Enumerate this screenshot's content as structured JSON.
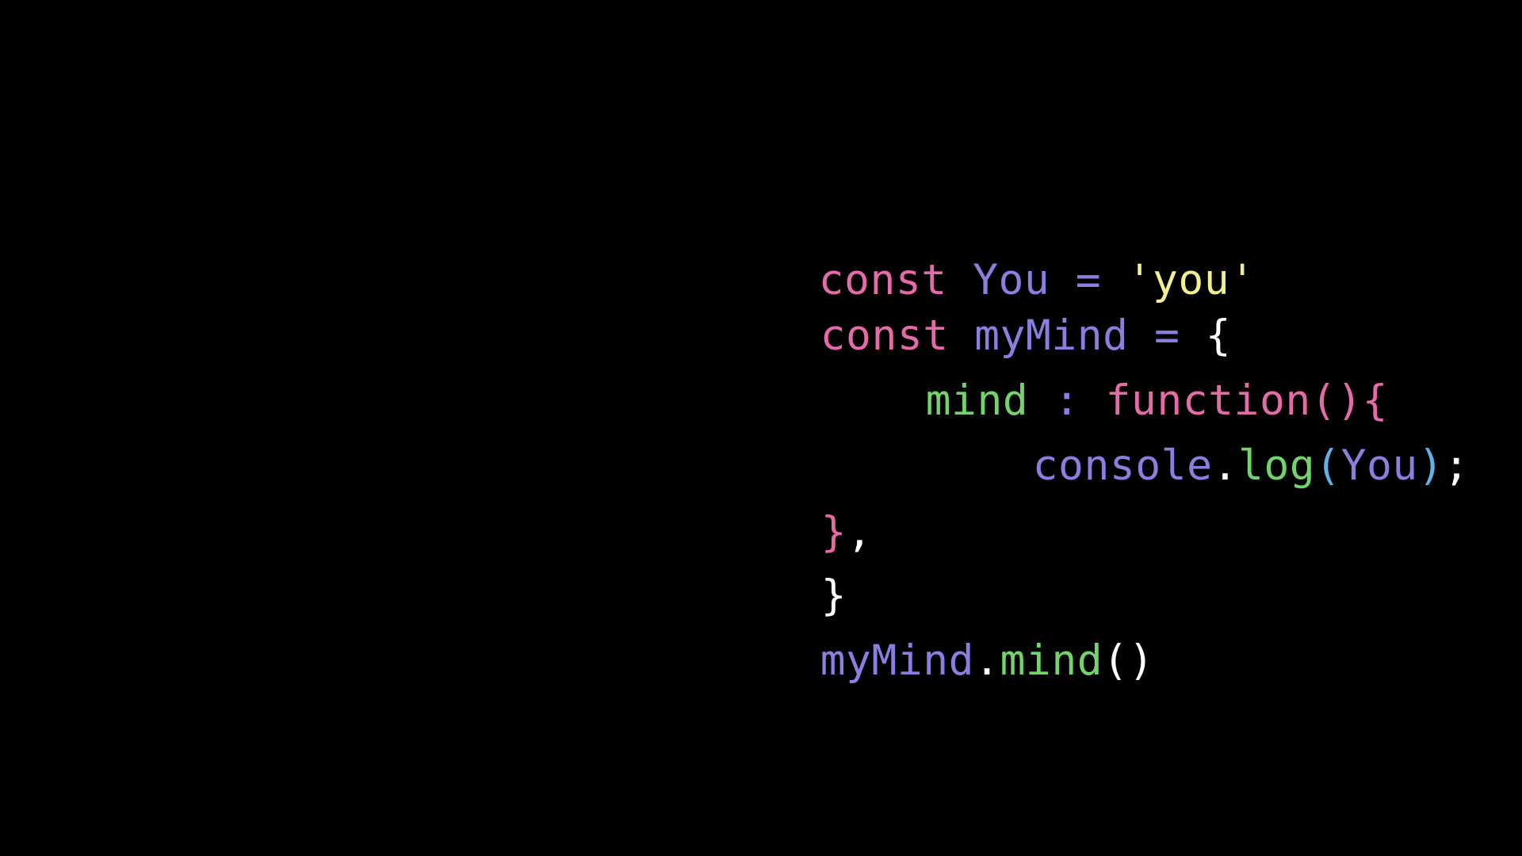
{
  "colors": {
    "background": "#000000",
    "keyword": "#e46aa8",
    "identifier": "#8a7fe0",
    "string": "#f1f08c",
    "property": "#72d46a",
    "punctuation": "#ffffff",
    "paren_highlight": "#5ab4e8"
  },
  "lines": [
    {
      "tokens": [
        {
          "text": "const ",
          "kind": "keyword"
        },
        {
          "text": "You",
          "kind": "identifier"
        },
        {
          "text": " = ",
          "kind": "identifier"
        },
        {
          "text": "'you'",
          "kind": "string"
        }
      ]
    },
    {
      "tokens": [
        {
          "text": "const ",
          "kind": "keyword"
        },
        {
          "text": "myMind",
          "kind": "identifier"
        },
        {
          "text": " = ",
          "kind": "identifier"
        },
        {
          "text": "{",
          "kind": "punctuation"
        }
      ]
    },
    {
      "tokens": [
        {
          "text": "mind",
          "kind": "property"
        },
        {
          "text": " : ",
          "kind": "identifier"
        },
        {
          "text": "function(){",
          "kind": "keyword"
        }
      ]
    },
    {
      "tokens": [
        {
          "text": "console",
          "kind": "identifier"
        },
        {
          "text": ".",
          "kind": "punctuation"
        },
        {
          "text": "log",
          "kind": "property"
        },
        {
          "text": "(",
          "kind": "paren_highlight"
        },
        {
          "text": "You",
          "kind": "identifier"
        },
        {
          "text": ")",
          "kind": "paren_highlight"
        },
        {
          "text": ";",
          "kind": "punctuation"
        }
      ]
    },
    {
      "tokens": [
        {
          "text": "}",
          "kind": "keyword"
        },
        {
          "text": ",",
          "kind": "punctuation"
        }
      ]
    },
    {
      "tokens": [
        {
          "text": "}",
          "kind": "punctuation"
        }
      ]
    },
    {
      "tokens": [
        {
          "text": "myMind",
          "kind": "identifier"
        },
        {
          "text": ".",
          "kind": "punctuation"
        },
        {
          "text": "mind",
          "kind": "property"
        },
        {
          "text": "()",
          "kind": "punctuation"
        }
      ]
    }
  ]
}
